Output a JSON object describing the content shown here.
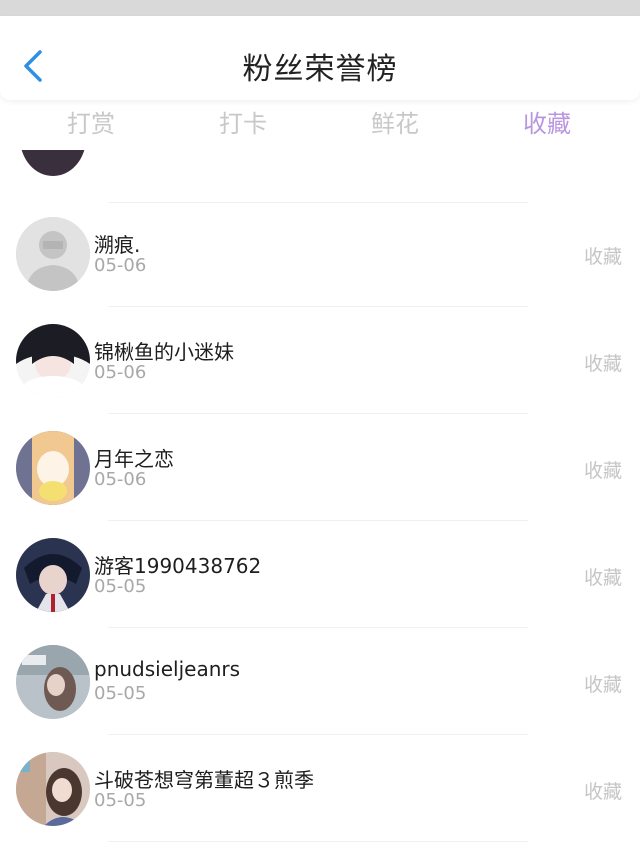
{
  "header": {
    "title": "粉丝荣誉榜"
  },
  "tabs": [
    {
      "label": "打赏",
      "active": false
    },
    {
      "label": "打卡",
      "active": false
    },
    {
      "label": "鲜花",
      "active": false
    },
    {
      "label": "收藏",
      "active": true
    }
  ],
  "colors": {
    "active_tab": "#b896e0",
    "inactive_tab": "#c8c8c8",
    "meta_text": "#a8a8a8"
  },
  "fans": [
    {
      "name": "溯痕.",
      "date": "05-06",
      "tag": "收藏",
      "avatar_icon": "default-avatar-icon"
    },
    {
      "name": "锦楸鱼的小迷妹",
      "date": "05-06",
      "tag": "收藏",
      "avatar_icon": "anime-girl-avatar-icon"
    },
    {
      "name": "月年之恋",
      "date": "05-06",
      "tag": "收藏",
      "avatar_icon": "cartoon-girl-avatar-icon"
    },
    {
      "name": "游客1990438762",
      "date": "05-05",
      "tag": "收藏",
      "avatar_icon": "anime-boy-avatar-icon"
    },
    {
      "name": "pnudsieljeanrs",
      "date": "05-05",
      "tag": "收藏",
      "avatar_icon": "photo-avatar-icon"
    },
    {
      "name": "斗破苍想穹第董超３煎季",
      "date": "05-05",
      "tag": "收藏",
      "avatar_icon": "girl-photo-avatar-icon"
    }
  ]
}
